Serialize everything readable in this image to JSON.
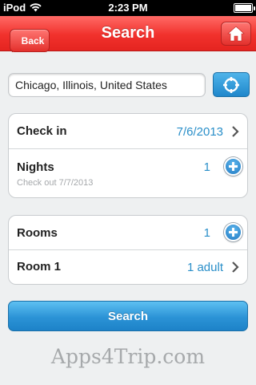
{
  "status_bar": {
    "carrier": "iPod",
    "time": "2:23 PM",
    "battery_level": 1.0
  },
  "nav": {
    "back_label": "Back",
    "title": "Search",
    "home_icon": "home-icon"
  },
  "location": {
    "value": "Chicago, Illinois, United States",
    "locate_icon": "crosshair-icon"
  },
  "stay": {
    "checkin_label": "Check in",
    "checkin_value": "7/6/2013",
    "nights_label": "Nights",
    "nights_value": "1",
    "checkout_text": "Check out 7/7/2013"
  },
  "rooms": {
    "rooms_label": "Rooms",
    "rooms_value": "1",
    "room1_label": "Room 1",
    "room1_value": "1 adult"
  },
  "search_button": "Search",
  "watermark": "Apps4Trip.com",
  "colors": {
    "nav_red": "#f1312c",
    "accent_blue": "#2a8fc9",
    "button_blue": "#2b93d6"
  }
}
